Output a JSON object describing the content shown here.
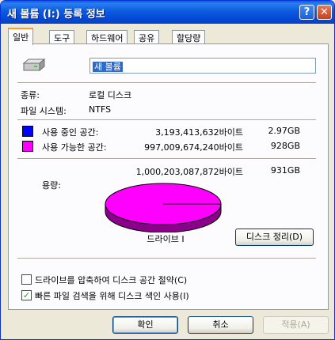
{
  "window": {
    "title": "새 볼륨 (I:) 등록 정보",
    "help_label": "?",
    "close_label": "✕"
  },
  "tabs": [
    {
      "label": "일반",
      "active": true
    },
    {
      "label": "도구",
      "active": false
    },
    {
      "label": "하드웨어",
      "active": false
    },
    {
      "label": "공유",
      "active": false
    },
    {
      "label": "할당량",
      "active": false
    }
  ],
  "general": {
    "volume_name": "새 볼륨",
    "type_label": "종류:",
    "type_value": "로컬 디스크",
    "fs_label": "파일 시스템:",
    "fs_value": "NTFS",
    "used": {
      "label": "사용 중인 공간:",
      "bytes": "3,193,413,632바이트",
      "size": "2.97GB",
      "color": "#0000ff"
    },
    "free": {
      "label": "사용 가능한 공간:",
      "bytes": "997,009,674,240바이트",
      "size": "928GB",
      "color": "#ff00ff"
    },
    "capacity": {
      "label": "용량:",
      "bytes": "1,000,203,087,872바이트",
      "size": "931GB"
    },
    "used_fraction": 0.0032,
    "drive_label": "드라이브 I",
    "cleanup_button": "디스크 정리(D)",
    "compress_checkbox": {
      "label": "드라이브를 압축하여 디스크 공간 절약(C)",
      "checked": false
    },
    "index_checkbox": {
      "label": "빠른 파일 검색을 위해 디스크 색인 사용(I)",
      "checked": true
    }
  },
  "footer": {
    "ok": "확인",
    "cancel": "취소",
    "apply": "적용(A)"
  }
}
